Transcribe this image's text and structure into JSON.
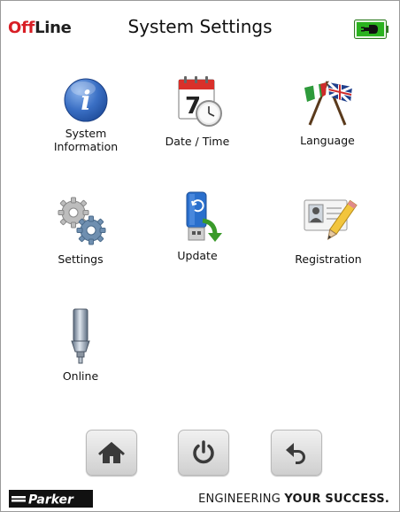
{
  "header": {
    "status_prefix": "Off",
    "status_suffix": "Line",
    "title": "System Settings",
    "battery_icon": "battery-plugged-icon"
  },
  "tiles": [
    {
      "label_line1": "System",
      "label_line2": "Information",
      "icon": "info-icon"
    },
    {
      "label_line1": "Date / Time",
      "label_line2": "",
      "icon": "calendar-clock-icon"
    },
    {
      "label_line1": "Language",
      "label_line2": "",
      "icon": "flags-icon"
    },
    {
      "label_line1": "Settings",
      "label_line2": "",
      "icon": "gears-icon"
    },
    {
      "label_line1": "Update",
      "label_line2": "",
      "icon": "usb-update-icon"
    },
    {
      "label_line1": "Registration",
      "label_line2": "",
      "icon": "id-card-pencil-icon"
    },
    {
      "label_line1": "Online",
      "label_line2": "",
      "icon": "probe-icon"
    }
  ],
  "footer": {
    "buttons": [
      {
        "name": "home",
        "icon": "home-icon"
      },
      {
        "name": "power",
        "icon": "power-icon"
      },
      {
        "name": "back",
        "icon": "back-arrow-icon"
      }
    ],
    "brand": "Parker",
    "tagline_regular": "ENGINEERING ",
    "tagline_bold": "YOUR SUCCESS."
  },
  "colors": {
    "offline_red": "#d81e25",
    "battery_green": "#2bb21f",
    "info_blue": "#2a5fb5"
  }
}
